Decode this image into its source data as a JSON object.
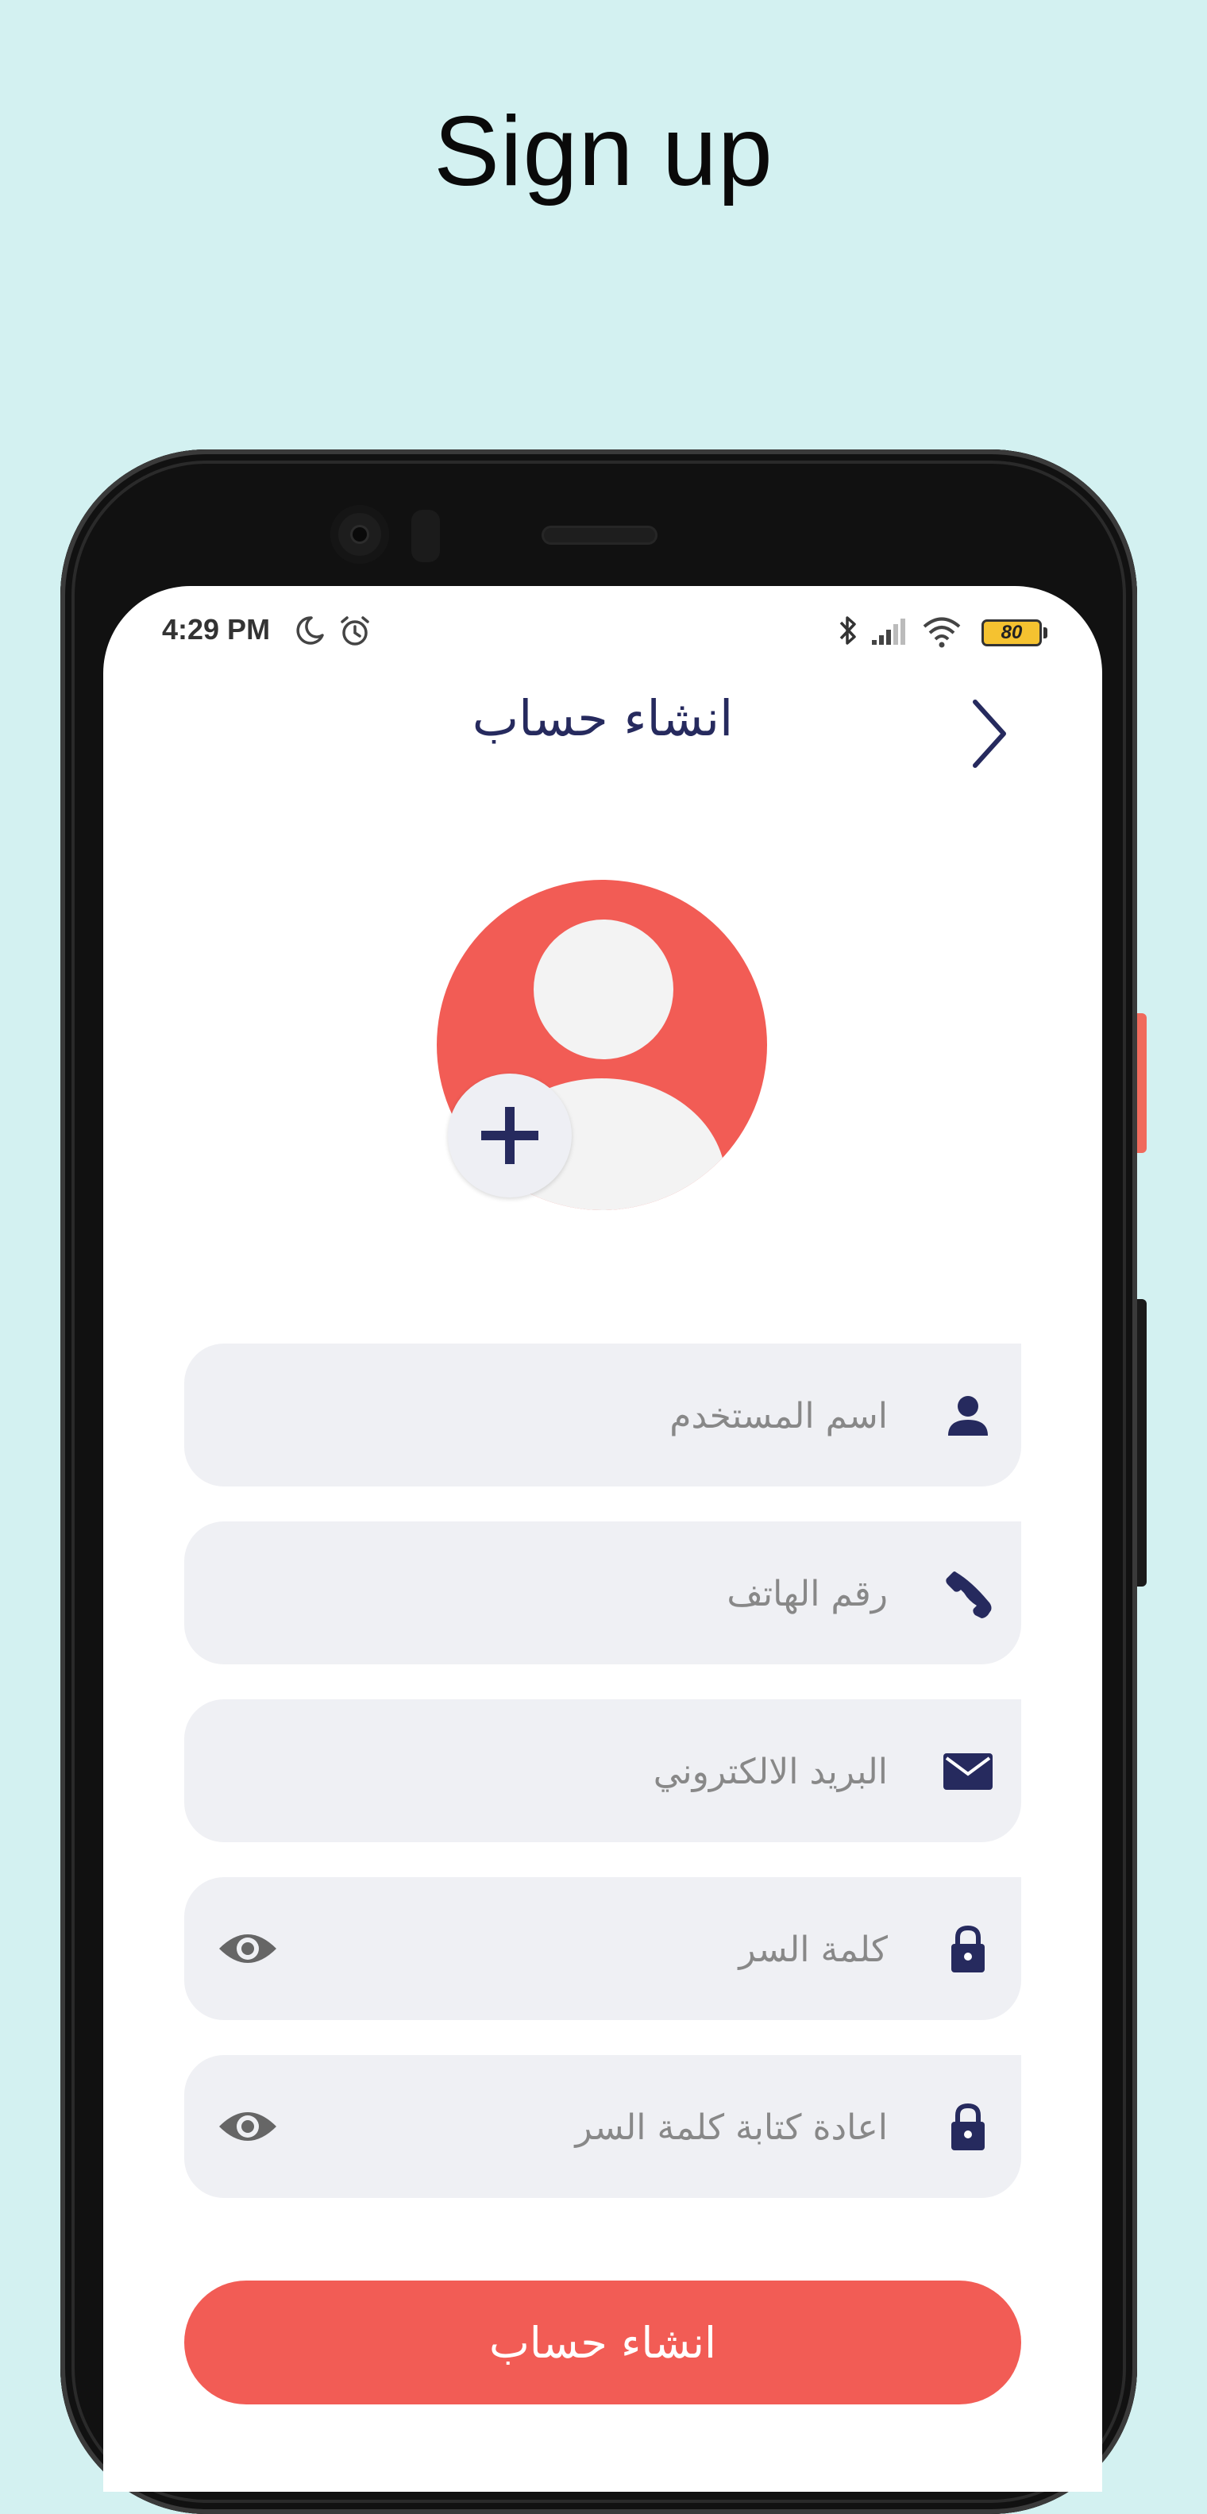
{
  "promo": {
    "title": "Sign up"
  },
  "status_bar": {
    "time": "4:29 PM",
    "battery": "80",
    "icons": [
      "moon-icon",
      "alarm-icon",
      "bluetooth-icon",
      "signal-icon",
      "wifi-icon",
      "battery-icon"
    ]
  },
  "header": {
    "title": "انشاء حساب",
    "back_icon": "chevron-right-icon"
  },
  "avatar": {
    "icon": "user-avatar-icon",
    "add_icon": "plus-icon"
  },
  "form": {
    "fields": [
      {
        "placeholder": "اسم المستخدم",
        "icon": "user-icon",
        "value": ""
      },
      {
        "placeholder": "رقم الهاتف",
        "icon": "phone-icon",
        "value": ""
      },
      {
        "placeholder": "البريد الالكتروني",
        "icon": "mail-icon",
        "value": ""
      },
      {
        "placeholder": "كلمة السر",
        "icon": "lock-icon",
        "toggle_icon": "eye-icon",
        "value": ""
      },
      {
        "placeholder": "اعادة كتابة كلمة السر",
        "icon": "lock-icon",
        "toggle_icon": "eye-icon",
        "value": ""
      }
    ],
    "submit_label": "انشاء حساب"
  },
  "colors": {
    "background": "#d3f1f1",
    "accent": "#f25c55",
    "navy": "#262a5e",
    "field_bg": "#eff0f4"
  }
}
